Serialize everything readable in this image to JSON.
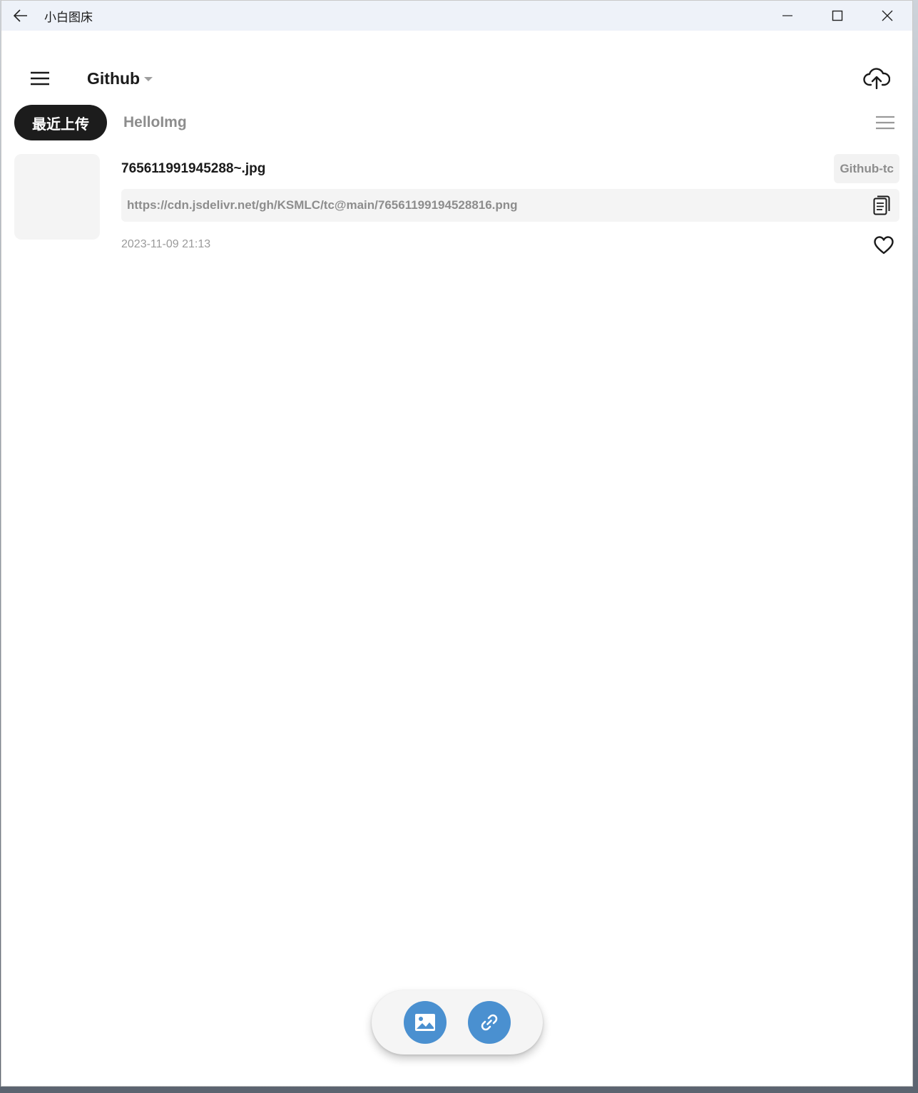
{
  "window": {
    "title": "小白图床"
  },
  "header": {
    "host_name": "Github"
  },
  "tabs": [
    {
      "label": "最近上传",
      "active": true
    },
    {
      "label": "HelloImg",
      "active": false
    }
  ],
  "items": [
    {
      "filename": "765611991945288~.jpg",
      "tag": "Github-tc",
      "url": "https://cdn.jsdelivr.net/gh/KSMLC/tc@main/76561199194528816.png",
      "date": "2023-11-09 21:13"
    }
  ],
  "colors": {
    "titlebar": "#eef2f9",
    "active_tab": "#1c1c1c",
    "fab": "#4a90d0",
    "muted_text": "#8d8d8d"
  },
  "icons": {
    "back": "arrow-left-icon",
    "minimize": "minimize-icon",
    "maximize": "maximize-icon",
    "close": "close-icon",
    "menu": "hamburger-menu-icon",
    "upload": "cloud-upload-icon",
    "list": "list-view-icon",
    "copy": "copy-icon",
    "favorite": "heart-icon",
    "image": "image-icon",
    "link": "link-icon"
  }
}
